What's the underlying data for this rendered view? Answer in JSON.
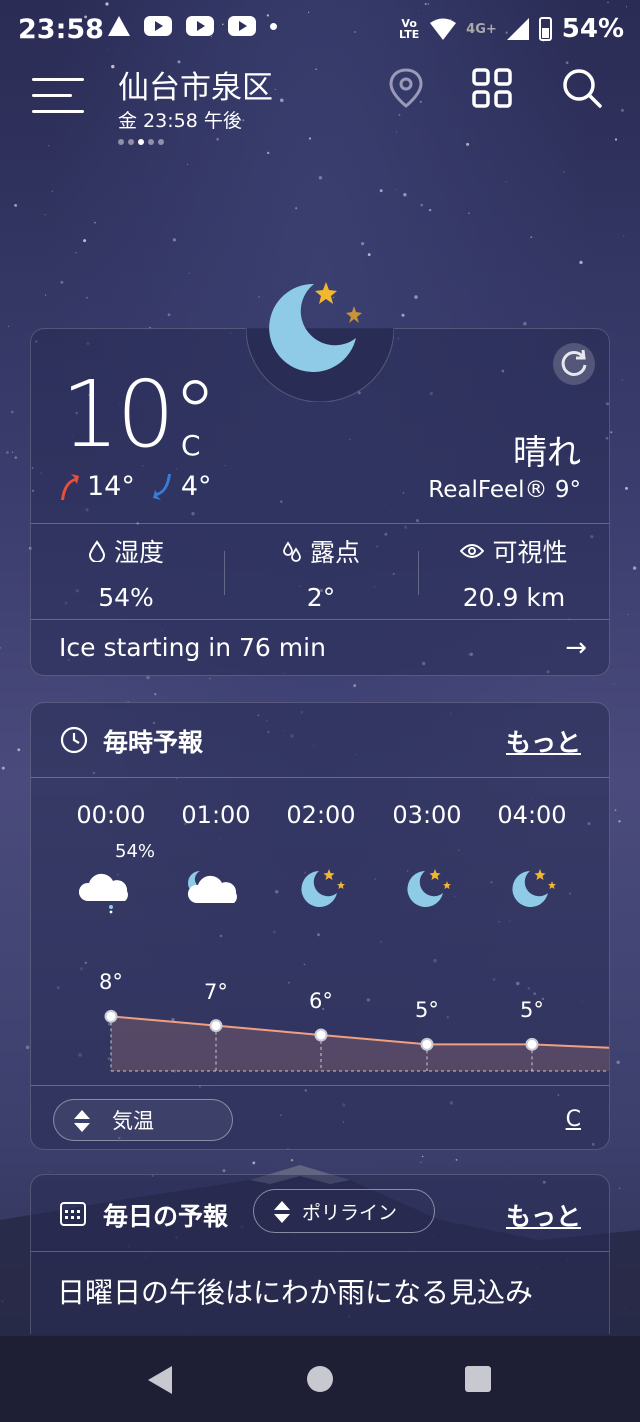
{
  "status_bar": {
    "time": "23:58",
    "network": "4G+",
    "volte": "Vo LTE",
    "battery": "54%"
  },
  "header": {
    "city": "仙台市泉区",
    "datetime": "金 23:58 午後",
    "page_count": 5,
    "active_page": 2
  },
  "current": {
    "temp": "10°",
    "unit": "C",
    "high": "14°",
    "low": "4°",
    "condition": "晴れ",
    "realfeel": "RealFeel® 9°",
    "metrics": [
      {
        "label": "湿度",
        "value": "54%",
        "icon": "humidity-drop-icon"
      },
      {
        "label": "露点",
        "value": "2°",
        "icon": "dew-point-icon"
      },
      {
        "label": "可視性",
        "value": "20.9 km",
        "icon": "eye-icon"
      }
    ],
    "alert": "Ice starting in 76 min"
  },
  "hourly": {
    "title": "毎時予報",
    "more": "もっと",
    "hours": [
      {
        "time": "00:00",
        "temp": "8°",
        "precip": "54%",
        "icon": "cloud-rain-icon"
      },
      {
        "time": "01:00",
        "temp": "7°",
        "precip": "",
        "icon": "partly-cloudy-night-icon"
      },
      {
        "time": "02:00",
        "temp": "6°",
        "precip": "",
        "icon": "clear-night-icon"
      },
      {
        "time": "03:00",
        "temp": "5°",
        "precip": "",
        "icon": "clear-night-icon"
      },
      {
        "time": "04:00",
        "temp": "5°",
        "precip": "",
        "icon": "clear-night-icon"
      }
    ],
    "toggle_label": "気温",
    "unit": "C"
  },
  "daily": {
    "title": "毎日の予報",
    "more": "もっと",
    "mode": "ポリライン",
    "forecast_text": "日曜日の午後はにわか雨になる見込み"
  },
  "colors": {
    "accent_high": "#e8503a",
    "accent_low": "#3a7bd5",
    "moon": "#8fcbe6",
    "star": "#f2b72e",
    "temp_line": "#f0a080"
  }
}
